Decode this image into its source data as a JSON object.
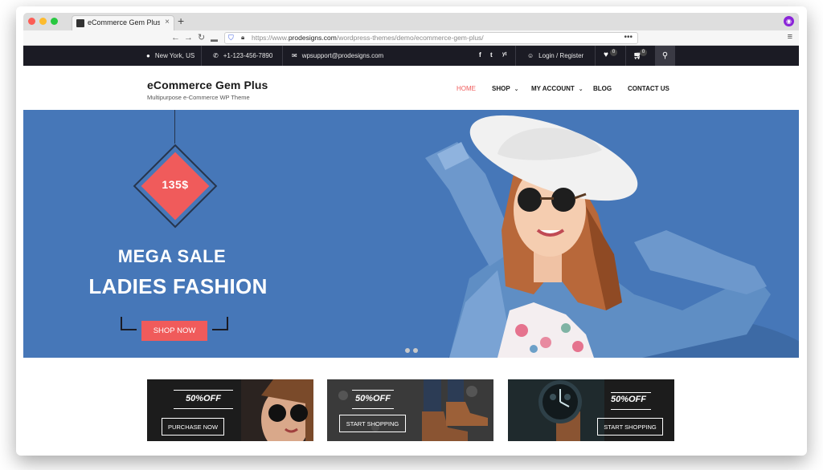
{
  "browser": {
    "tab_title": "eCommerce Gem Plus – P",
    "tab_close": "×",
    "new_tab": "+",
    "url_prefix": "https://www.",
    "url_domain": "prodesigns.com",
    "url_path": "/wordpress-themes/demo/ecommerce-gem-plus/",
    "url_more": "•••",
    "menu": "≡"
  },
  "topbar": {
    "location": "New York, US",
    "phone": "+1-123-456-7890",
    "email": "wpsupport@prodesigns.com",
    "social": [
      "f",
      "t",
      "yt"
    ],
    "login": "Login / Register",
    "wishlist_count": "0",
    "cart_count": "0"
  },
  "header": {
    "site_title": "eCommerce Gem Plus",
    "tagline": "Multipurpose e-Commerce WP Theme",
    "menu": [
      {
        "label": "HOME",
        "active": true
      },
      {
        "label": "SHOP",
        "dropdown": true
      },
      {
        "label": "MY ACCOUNT",
        "dropdown": true
      },
      {
        "label": "BLOG"
      },
      {
        "label": "CONTACT US"
      }
    ]
  },
  "hero": {
    "price": "135$",
    "headline_1": "MEGA SALE",
    "headline_2": "LADIES FASHION",
    "cta": "SHOP NOW",
    "colors": {
      "background": "#4677b8",
      "accent": "#f05b5b"
    },
    "slide_count": 2
  },
  "promos": [
    {
      "discount": "50%OFF",
      "button": "PURCHASE NOW"
    },
    {
      "discount": "50%OFF",
      "button": "START SHOPPING"
    },
    {
      "discount": "50%OFF",
      "button": "START SHOPPING"
    }
  ]
}
